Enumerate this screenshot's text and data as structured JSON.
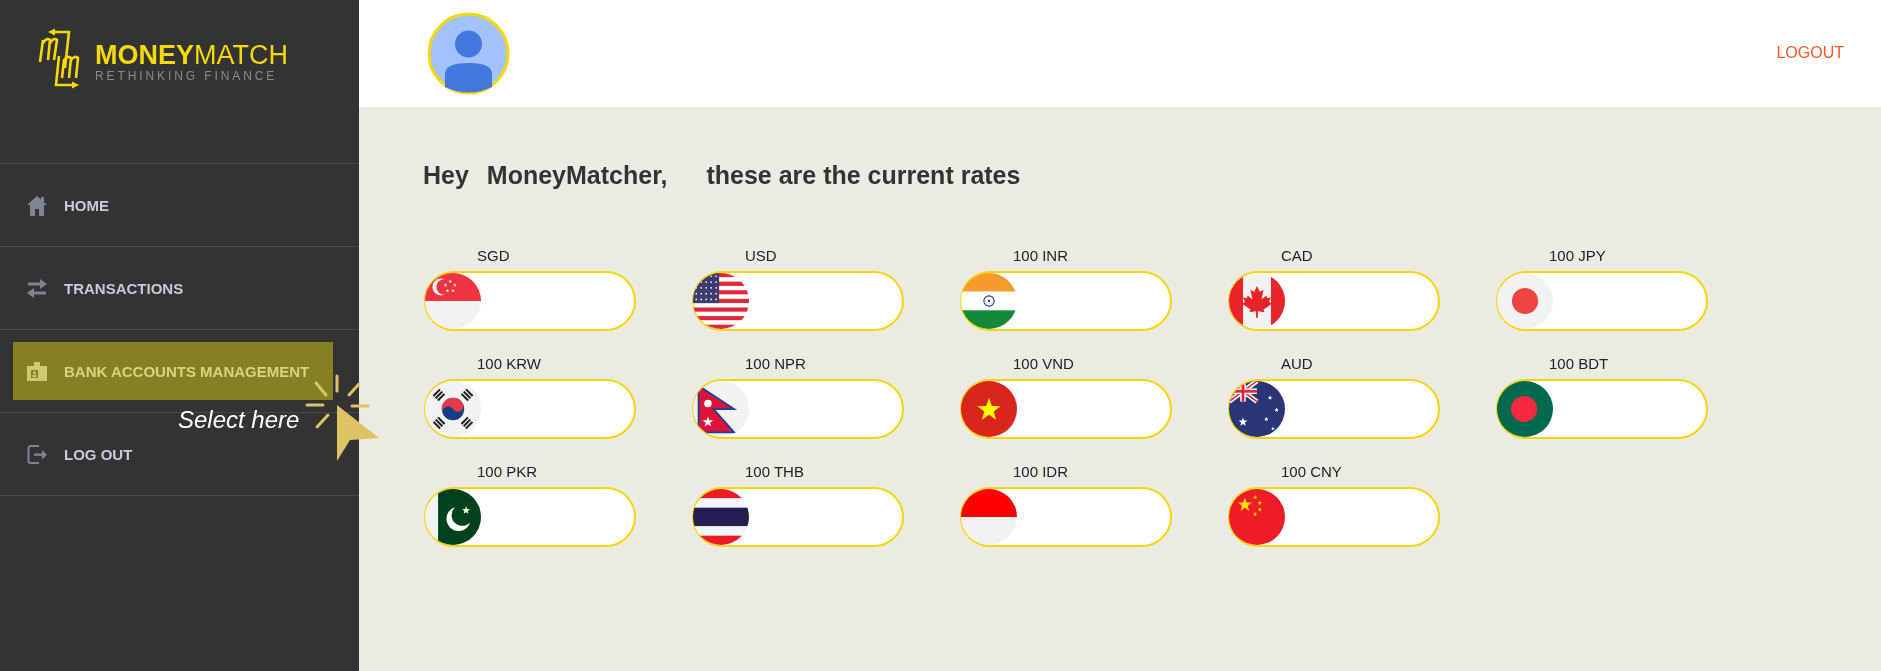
{
  "sidebar": {
    "logo": {
      "wordmark": "**MONEY**MATCH",
      "tagline": "RETHINKING FINANCE"
    },
    "items": [
      {
        "label": "HOME",
        "kind": "home",
        "selected": false
      },
      {
        "label": "TRANSACTIONS",
        "kind": "transactions",
        "selected": false
      },
      {
        "label": "BANK ACCOUNTS MANAGEMENT",
        "kind": "bank",
        "selected": true
      },
      {
        "label": "LOG OUT",
        "kind": "logout",
        "selected": false
      }
    ],
    "hint": {
      "text": "Select here"
    }
  },
  "header": {
    "logout": "LOGOUT"
  },
  "greeting": {
    "salutation": "Hey",
    "user": "MoneyMatcher,",
    "message": "these are the current rates"
  },
  "rates": [
    {
      "currency": "SGD",
      "kind": "sg"
    },
    {
      "currency": "USD",
      "kind": "us"
    },
    {
      "currency": "100 INR",
      "kind": "in"
    },
    {
      "currency": "CAD",
      "kind": "ca"
    },
    {
      "currency": "100 JPY",
      "kind": "jp"
    },
    {
      "currency": "100 KRW",
      "kind": "kr"
    },
    {
      "currency": "100 NPR",
      "kind": "np"
    },
    {
      "currency": "100 VND",
      "kind": "vn"
    },
    {
      "currency": "AUD",
      "kind": "au"
    },
    {
      "currency": "100 BDT",
      "kind": "bd"
    },
    {
      "currency": "100 PKR",
      "kind": "pk"
    },
    {
      "currency": "100 THB",
      "kind": "th"
    },
    {
      "currency": "100 IDR",
      "kind": "id"
    },
    {
      "currency": "100 CNY",
      "kind": "cn"
    }
  ]
}
